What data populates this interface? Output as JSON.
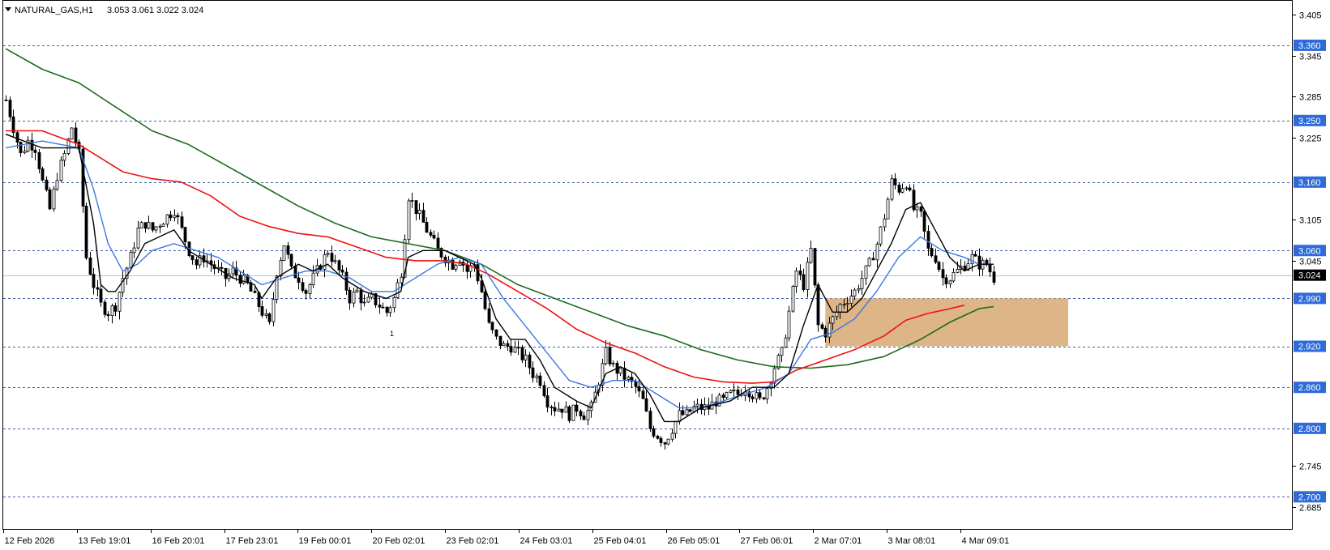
{
  "header": {
    "symbol": "NATURAL_GAS,H1",
    "ohlc": "3.053 3.061 3.022 3.024"
  },
  "chart_data": {
    "type": "candlestick",
    "symbol": "NATURAL_GAS",
    "timeframe": "H1",
    "ylim": [
      2.653,
      3.425
    ],
    "y_tick_labels": [
      "3.405",
      "3.345",
      "3.285",
      "3.225",
      "3.105",
      "3.045",
      "2.745",
      "2.685"
    ],
    "x_tick_labels": [
      "12 Feb 2026",
      "13 Feb 19:01",
      "16 Feb 20:01",
      "17 Feb 23:01",
      "19 Feb 00:01",
      "20 Feb 02:01",
      "23 Feb 02:01",
      "24 Feb 03:01",
      "25 Feb 04:01",
      "26 Feb 05:01",
      "27 Feb 06:01",
      "2 Mar 07:01",
      "3 Mar 08:01",
      "4 Mar 09:01"
    ],
    "horizontal_levels": [
      "3.360",
      "3.250",
      "3.160",
      "3.060",
      "2.990",
      "2.920",
      "2.860",
      "2.800",
      "2.700"
    ],
    "current_price": "3.024",
    "zone": {
      "y_top": 2.99,
      "y_bottom": 2.92,
      "color": "#d8a872"
    },
    "annotation": "1",
    "candle_path": [
      [
        0,
        3.28
      ],
      [
        2,
        3.24
      ],
      [
        4,
        3.2
      ],
      [
        6,
        3.22
      ],
      [
        8,
        3.21
      ],
      [
        10,
        3.16
      ],
      [
        12,
        3.12
      ],
      [
        14,
        3.17
      ],
      [
        16,
        3.2
      ],
      [
        18,
        3.24
      ],
      [
        20,
        3.2
      ],
      [
        22,
        3.05
      ],
      [
        24,
        3.01
      ],
      [
        26,
        2.98
      ],
      [
        28,
        2.97
      ],
      [
        30,
        2.98
      ],
      [
        32,
        3.02
      ],
      [
        34,
        3.05
      ],
      [
        36,
        3.09
      ],
      [
        38,
        3.1
      ],
      [
        40,
        3.09
      ],
      [
        42,
        3.1
      ],
      [
        44,
        3.11
      ],
      [
        46,
        3.12
      ],
      [
        48,
        3.09
      ],
      [
        50,
        3.06
      ],
      [
        52,
        3.04
      ],
      [
        54,
        3.05
      ],
      [
        56,
        3.04
      ],
      [
        58,
        3.03
      ],
      [
        60,
        3.02
      ],
      [
        62,
        3.03
      ],
      [
        64,
        3.02
      ],
      [
        66,
        3.01
      ],
      [
        68,
        2.99
      ],
      [
        70,
        2.97
      ],
      [
        72,
        2.95
      ],
      [
        74,
        3.03
      ],
      [
        76,
        3.07
      ],
      [
        78,
        3.03
      ],
      [
        80,
        3.02
      ],
      [
        82,
        3.0
      ],
      [
        84,
        3.02
      ],
      [
        86,
        3.04
      ],
      [
        88,
        3.06
      ],
      [
        90,
        3.04
      ],
      [
        92,
        3.02
      ],
      [
        94,
        2.99
      ],
      [
        96,
        3.0
      ],
      [
        98,
        2.98
      ],
      [
        100,
        2.99
      ],
      [
        102,
        2.98
      ],
      [
        104,
        2.97
      ],
      [
        106,
        2.99
      ],
      [
        108,
        3.03
      ],
      [
        110,
        3.14
      ],
      [
        112,
        3.12
      ],
      [
        114,
        3.1
      ],
      [
        116,
        3.08
      ],
      [
        118,
        3.06
      ],
      [
        120,
        3.05
      ],
      [
        122,
        3.04
      ],
      [
        124,
        3.05
      ],
      [
        126,
        3.03
      ],
      [
        128,
        3.04
      ],
      [
        130,
        3.0
      ],
      [
        132,
        2.95
      ],
      [
        134,
        2.93
      ],
      [
        136,
        2.92
      ],
      [
        138,
        2.92
      ],
      [
        140,
        2.91
      ],
      [
        142,
        2.9
      ],
      [
        144,
        2.88
      ],
      [
        146,
        2.87
      ],
      [
        148,
        2.84
      ],
      [
        150,
        2.83
      ],
      [
        152,
        2.83
      ],
      [
        154,
        2.82
      ],
      [
        156,
        2.83
      ],
      [
        158,
        2.82
      ],
      [
        160,
        2.83
      ],
      [
        162,
        2.87
      ],
      [
        164,
        2.91
      ],
      [
        166,
        2.89
      ],
      [
        168,
        2.88
      ],
      [
        170,
        2.87
      ],
      [
        172,
        2.86
      ],
      [
        174,
        2.84
      ],
      [
        176,
        2.8
      ],
      [
        178,
        2.79
      ],
      [
        180,
        2.78
      ],
      [
        182,
        2.8
      ],
      [
        184,
        2.82
      ],
      [
        186,
        2.82
      ],
      [
        188,
        2.83
      ],
      [
        190,
        2.83
      ],
      [
        192,
        2.83
      ],
      [
        194,
        2.84
      ],
      [
        196,
        2.84
      ],
      [
        198,
        2.85
      ],
      [
        200,
        2.85
      ],
      [
        202,
        2.86
      ],
      [
        204,
        2.85
      ],
      [
        206,
        2.84
      ],
      [
        208,
        2.86
      ],
      [
        210,
        2.89
      ],
      [
        212,
        2.91
      ],
      [
        214,
        2.97
      ],
      [
        216,
        3.03
      ],
      [
        218,
        3.01
      ],
      [
        220,
        3.06
      ],
      [
        222,
        2.95
      ],
      [
        224,
        2.94
      ],
      [
        226,
        2.96
      ],
      [
        228,
        2.98
      ],
      [
        230,
        2.99
      ],
      [
        232,
        3.0
      ],
      [
        234,
        3.02
      ],
      [
        236,
        3.04
      ],
      [
        238,
        3.07
      ],
      [
        240,
        3.11
      ],
      [
        242,
        3.16
      ],
      [
        244,
        3.15
      ],
      [
        246,
        3.16
      ],
      [
        248,
        3.12
      ],
      [
        250,
        3.11
      ],
      [
        252,
        3.06
      ],
      [
        254,
        3.05
      ],
      [
        256,
        3.02
      ],
      [
        258,
        3.02
      ],
      [
        260,
        3.03
      ],
      [
        262,
        3.04
      ],
      [
        264,
        3.05
      ],
      [
        266,
        3.04
      ],
      [
        268,
        3.04
      ],
      [
        270,
        3.02
      ]
    ],
    "ma_black": [
      [
        0,
        3.23
      ],
      [
        10,
        3.21
      ],
      [
        20,
        3.21
      ],
      [
        24,
        3.1
      ],
      [
        26,
        3.01
      ],
      [
        28,
        3.0
      ],
      [
        30,
        3.0
      ],
      [
        34,
        3.03
      ],
      [
        38,
        3.07
      ],
      [
        42,
        3.08
      ],
      [
        46,
        3.09
      ],
      [
        50,
        3.06
      ],
      [
        56,
        3.04
      ],
      [
        62,
        3.02
      ],
      [
        68,
        3.01
      ],
      [
        70,
        2.99
      ],
      [
        74,
        3.02
      ],
      [
        80,
        3.04
      ],
      [
        84,
        3.03
      ],
      [
        88,
        3.04
      ],
      [
        92,
        3.02
      ],
      [
        98,
        3.0
      ],
      [
        104,
        2.99
      ],
      [
        108,
        3.0
      ],
      [
        110,
        3.05
      ],
      [
        114,
        3.06
      ],
      [
        120,
        3.06
      ],
      [
        124,
        3.05
      ],
      [
        128,
        3.04
      ],
      [
        130,
        3.02
      ],
      [
        134,
        2.96
      ],
      [
        138,
        2.93
      ],
      [
        142,
        2.93
      ],
      [
        146,
        2.9
      ],
      [
        150,
        2.86
      ],
      [
        156,
        2.84
      ],
      [
        160,
        2.83
      ],
      [
        164,
        2.88
      ],
      [
        168,
        2.89
      ],
      [
        172,
        2.88
      ],
      [
        176,
        2.85
      ],
      [
        180,
        2.81
      ],
      [
        184,
        2.81
      ],
      [
        190,
        2.83
      ],
      [
        198,
        2.84
      ],
      [
        204,
        2.86
      ],
      [
        210,
        2.86
      ],
      [
        214,
        2.88
      ],
      [
        218,
        2.95
      ],
      [
        222,
        3.01
      ],
      [
        226,
        2.97
      ],
      [
        230,
        2.97
      ],
      [
        234,
        2.99
      ],
      [
        238,
        3.03
      ],
      [
        242,
        3.07
      ],
      [
        246,
        3.12
      ],
      [
        250,
        3.13
      ],
      [
        254,
        3.09
      ],
      [
        258,
        3.05
      ],
      [
        262,
        3.03
      ],
      [
        266,
        3.04
      ],
      [
        270,
        3.04
      ]
    ],
    "ma_blue": [
      [
        0,
        3.21
      ],
      [
        10,
        3.22
      ],
      [
        20,
        3.21
      ],
      [
        24,
        3.15
      ],
      [
        28,
        3.07
      ],
      [
        32,
        3.03
      ],
      [
        36,
        3.04
      ],
      [
        40,
        3.06
      ],
      [
        46,
        3.07
      ],
      [
        52,
        3.06
      ],
      [
        58,
        3.05
      ],
      [
        64,
        3.03
      ],
      [
        70,
        3.01
      ],
      [
        76,
        3.02
      ],
      [
        82,
        3.03
      ],
      [
        88,
        3.03
      ],
      [
        94,
        3.02
      ],
      [
        100,
        3.0
      ],
      [
        106,
        3.0
      ],
      [
        112,
        3.02
      ],
      [
        118,
        3.04
      ],
      [
        124,
        3.05
      ],
      [
        130,
        3.04
      ],
      [
        136,
        2.99
      ],
      [
        142,
        2.95
      ],
      [
        148,
        2.91
      ],
      [
        154,
        2.87
      ],
      [
        160,
        2.86
      ],
      [
        166,
        2.87
      ],
      [
        172,
        2.87
      ],
      [
        178,
        2.85
      ],
      [
        184,
        2.83
      ],
      [
        190,
        2.83
      ],
      [
        196,
        2.84
      ],
      [
        202,
        2.85
      ],
      [
        208,
        2.86
      ],
      [
        214,
        2.88
      ],
      [
        220,
        2.93
      ],
      [
        226,
        2.94
      ],
      [
        232,
        2.96
      ],
      [
        238,
        3.0
      ],
      [
        244,
        3.05
      ],
      [
        250,
        3.08
      ],
      [
        256,
        3.06
      ],
      [
        262,
        3.05
      ],
      [
        266,
        3.04
      ],
      [
        270,
        3.04
      ]
    ],
    "ma_red": [
      [
        0,
        3.235
      ],
      [
        10,
        3.235
      ],
      [
        20,
        3.215
      ],
      [
        26,
        3.195
      ],
      [
        32,
        3.175
      ],
      [
        40,
        3.165
      ],
      [
        48,
        3.16
      ],
      [
        56,
        3.14
      ],
      [
        64,
        3.11
      ],
      [
        72,
        3.095
      ],
      [
        80,
        3.085
      ],
      [
        88,
        3.08
      ],
      [
        96,
        3.065
      ],
      [
        104,
        3.05
      ],
      [
        112,
        3.045
      ],
      [
        120,
        3.045
      ],
      [
        126,
        3.04
      ],
      [
        132,
        3.025
      ],
      [
        140,
        3.0
      ],
      [
        148,
        2.975
      ],
      [
        156,
        2.945
      ],
      [
        164,
        2.925
      ],
      [
        172,
        2.91
      ],
      [
        180,
        2.89
      ],
      [
        188,
        2.875
      ],
      [
        196,
        2.868
      ],
      [
        204,
        2.866
      ],
      [
        210,
        2.868
      ],
      [
        216,
        2.885
      ],
      [
        224,
        2.9
      ],
      [
        232,
        2.915
      ],
      [
        240,
        2.935
      ],
      [
        246,
        2.958
      ],
      [
        252,
        2.968
      ],
      [
        258,
        2.975
      ],
      [
        262,
        2.98
      ]
    ],
    "ma_green": [
      [
        0,
        3.355
      ],
      [
        10,
        3.325
      ],
      [
        20,
        3.305
      ],
      [
        30,
        3.27
      ],
      [
        40,
        3.235
      ],
      [
        50,
        3.215
      ],
      [
        60,
        3.185
      ],
      [
        70,
        3.155
      ],
      [
        80,
        3.125
      ],
      [
        90,
        3.1
      ],
      [
        100,
        3.08
      ],
      [
        110,
        3.07
      ],
      [
        120,
        3.06
      ],
      [
        130,
        3.04
      ],
      [
        140,
        3.01
      ],
      [
        150,
        2.99
      ],
      [
        160,
        2.97
      ],
      [
        170,
        2.95
      ],
      [
        180,
        2.935
      ],
      [
        190,
        2.915
      ],
      [
        200,
        2.9
      ],
      [
        210,
        2.89
      ],
      [
        220,
        2.888
      ],
      [
        230,
        2.893
      ],
      [
        240,
        2.905
      ],
      [
        250,
        2.93
      ],
      [
        258,
        2.955
      ],
      [
        266,
        2.975
      ],
      [
        270,
        2.978
      ]
    ],
    "colors": {
      "candle": "#000000",
      "ma_black": "#000000",
      "ma_blue": "#3c78e0",
      "ma_red": "#ee1111",
      "ma_green": "#1d6b1d",
      "level_line": "#3f5fa8",
      "level_badge": "#2e6bd8",
      "price_line": "#c0c0c0"
    }
  }
}
